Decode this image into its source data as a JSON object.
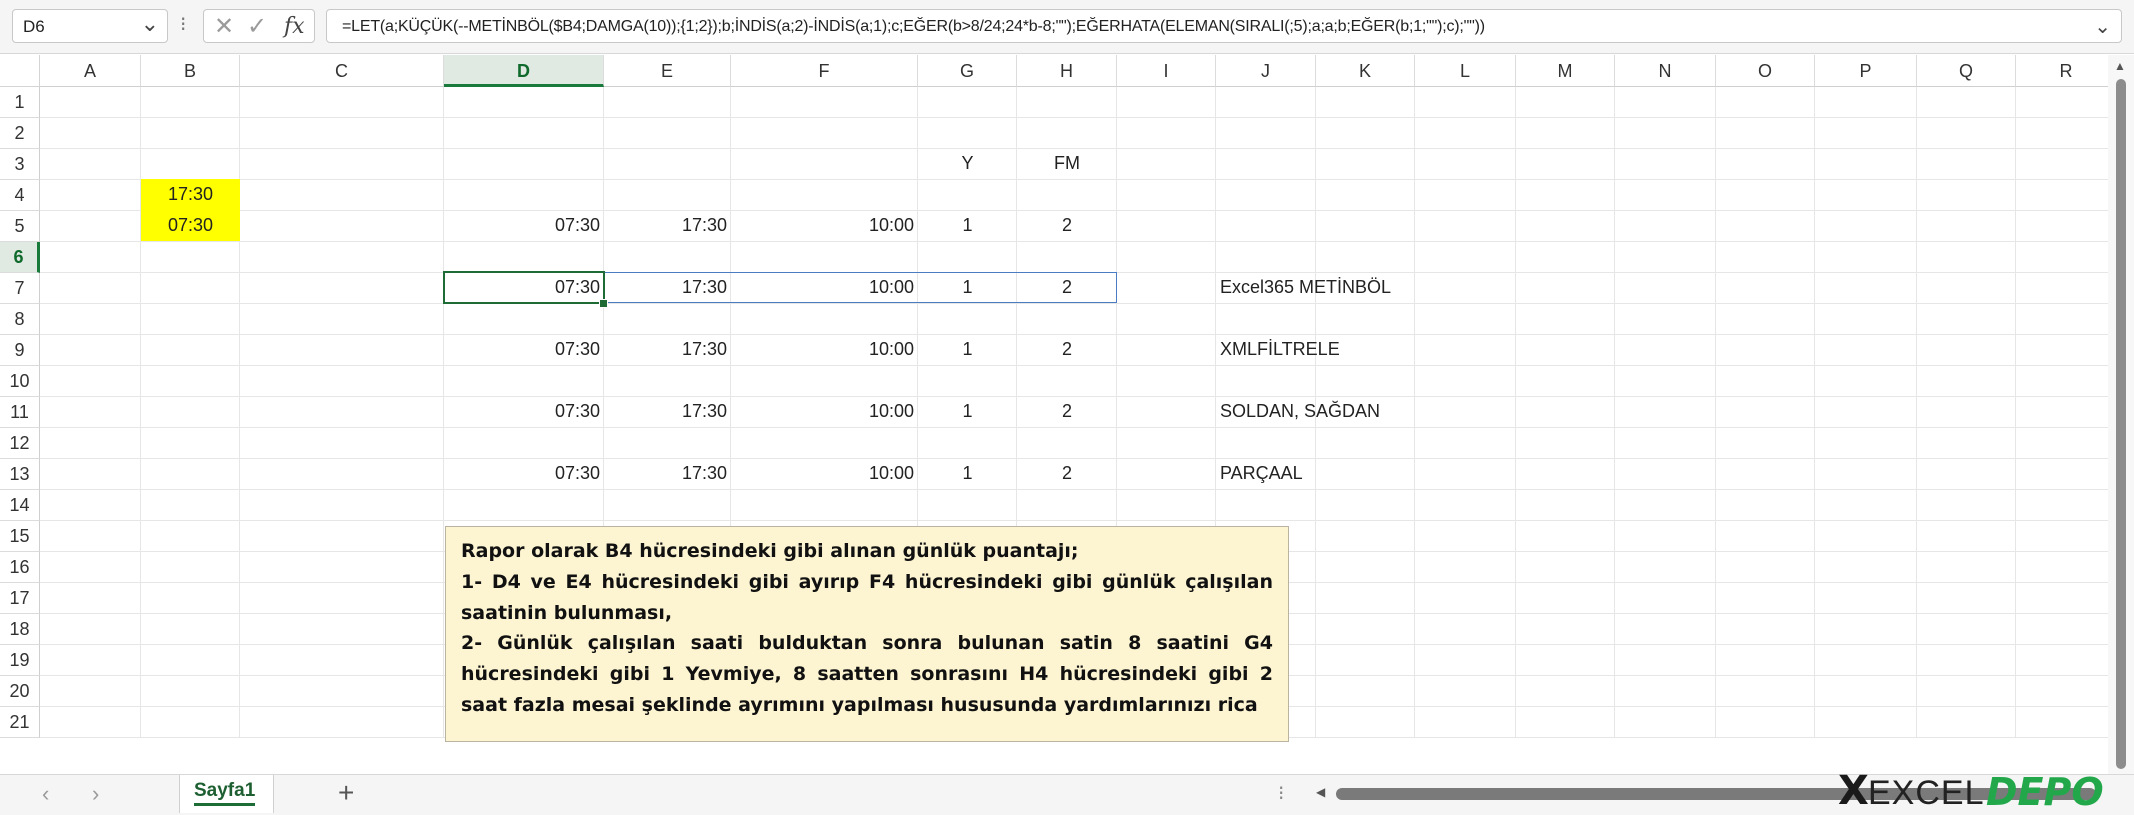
{
  "formula_bar": {
    "name_box": "D6",
    "formula": "=LET(a;KÜÇÜK(--METİNBÖL($B4;DAMGA(10));{1;2});b;İNDİS(a;2)-İNDİS(a;1);c;EĞER(b>8/24;24*b-8;\"\");EĞERHATA(ELEMAN(SIRALI(;5);a;a;b;EĞER(b;1;\"\");c);\"\"))"
  },
  "columns": [
    "A",
    "B",
    "C",
    "D",
    "E",
    "F",
    "G",
    "H",
    "I",
    "J",
    "K",
    "L",
    "M",
    "N",
    "O",
    "P",
    "Q",
    "R"
  ],
  "rows": [
    "1",
    "2",
    "3",
    "4",
    "5",
    "6",
    "7",
    "8",
    "9",
    "10",
    "11",
    "12",
    "13",
    "14",
    "15",
    "16",
    "17",
    "18",
    "19",
    "20",
    "21"
  ],
  "selected_cell": {
    "col": "D",
    "row": "6"
  },
  "cells": {
    "G3": "Y",
    "H3": "FM",
    "B4_line1": "17:30",
    "B4_line2": "07:30",
    "D4": "07:30",
    "E4": "17:30",
    "F4": "10:00",
    "G4": "1",
    "H4": "2",
    "D6": "07:30",
    "E6": "17:30",
    "F6": "10:00",
    "G6": "1",
    "H6": "2",
    "J6": "Excel365 METİNBÖL",
    "D8": "07:30",
    "E8": "17:30",
    "F8": "10:00",
    "G8": "1",
    "H8": "2",
    "J8": "XMLFİLTRELE",
    "D10": "07:30",
    "E10": "17:30",
    "F10": "10:00",
    "G10": "1",
    "H10": "2",
    "J10": "SOLDAN, SAĞDAN",
    "D12": "07:30",
    "E12": "17:30",
    "F12": "10:00",
    "G12": "1",
    "H12": "2",
    "J12": "PARÇAAL"
  },
  "note": {
    "line1": "Rapor olarak B4 hücresindeki gibi alınan günlük puantajı;",
    "line2": "1- D4 ve E4  hücresindeki gibi ayırıp F4 hücresindeki gibi günlük çalışılan saatinin bulunması,",
    "line3": "2- Günlük çalışılan saati bulduktan sonra bulunan satin 8 saatini G4 hücresindeki gibi 1 Yevmiye, 8 saatten sonrasını H4 hücresindeki gibi  2 saat fazla mesai şeklinde ayrımını yapılması hususunda yardımlarınızı rica"
  },
  "sheet_tabs": [
    {
      "label": "Sayfa1",
      "active": true
    }
  ],
  "logo": {
    "part1": "EXCEL",
    "part2": "DEPO"
  },
  "colors": {
    "accent": "#1e6b35",
    "highlight": "#ffff00",
    "note_bg": "#fdf5d2",
    "selection": "#4a7cc4"
  }
}
